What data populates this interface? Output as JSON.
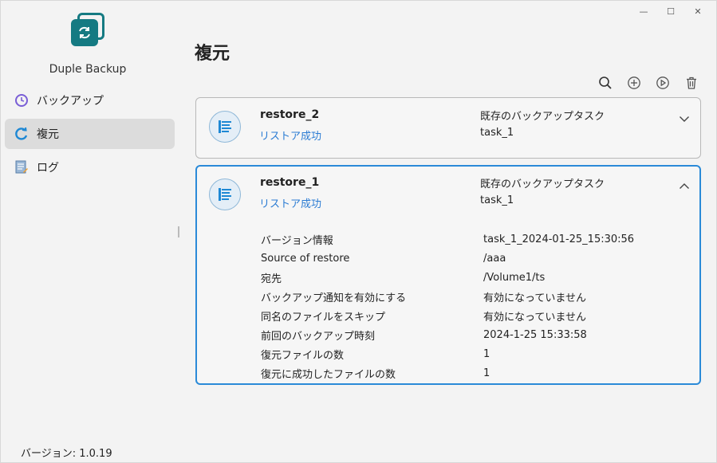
{
  "window": {
    "minimize": "—",
    "maximize": "☐",
    "close": "✕"
  },
  "app": {
    "name": "Duple Backup",
    "version_label": "バージョン: 1.0.19"
  },
  "sidebar": {
    "items": [
      {
        "label": "バックアップ",
        "icon": "clock-icon",
        "active": false
      },
      {
        "label": "複元",
        "icon": "restore-icon",
        "active": true
      },
      {
        "label": "ログ",
        "icon": "log-icon",
        "active": false
      }
    ]
  },
  "main": {
    "title": "複元",
    "toolbar": [
      "search-icon",
      "add-icon",
      "play-icon",
      "delete-icon"
    ]
  },
  "tasks": [
    {
      "name": "restore_2",
      "status": "リストア成功",
      "type": "既存のバックアップタスク",
      "task": "task_1",
      "expanded": false
    },
    {
      "name": "restore_1",
      "status": "リストア成功",
      "type": "既存のバックアップタスク",
      "task": "task_1",
      "expanded": true,
      "details": [
        {
          "label": "バージョン情報",
          "value": "task_1_2024-01-25_15:30:56"
        },
        {
          "label": "Source of restore",
          "value": "/aaa"
        },
        {
          "label": "宛先",
          "value": "/Volume1/ts"
        },
        {
          "label": "バックアップ通知を有効にする",
          "value": "有効になっていません"
        },
        {
          "label": "同名のファイルをスキップ",
          "value": "有効になっていません"
        },
        {
          "label": "前回のバックアップ時刻",
          "value": "2024-1-25 15:33:58"
        },
        {
          "label": "復元ファイルの数",
          "value": "1"
        },
        {
          "label": "復元に成功したファイルの数",
          "value": "1"
        }
      ]
    }
  ],
  "colors": {
    "accent": "#2a8ad8",
    "brand": "#157a82",
    "status_success": "#2a7bd3"
  }
}
